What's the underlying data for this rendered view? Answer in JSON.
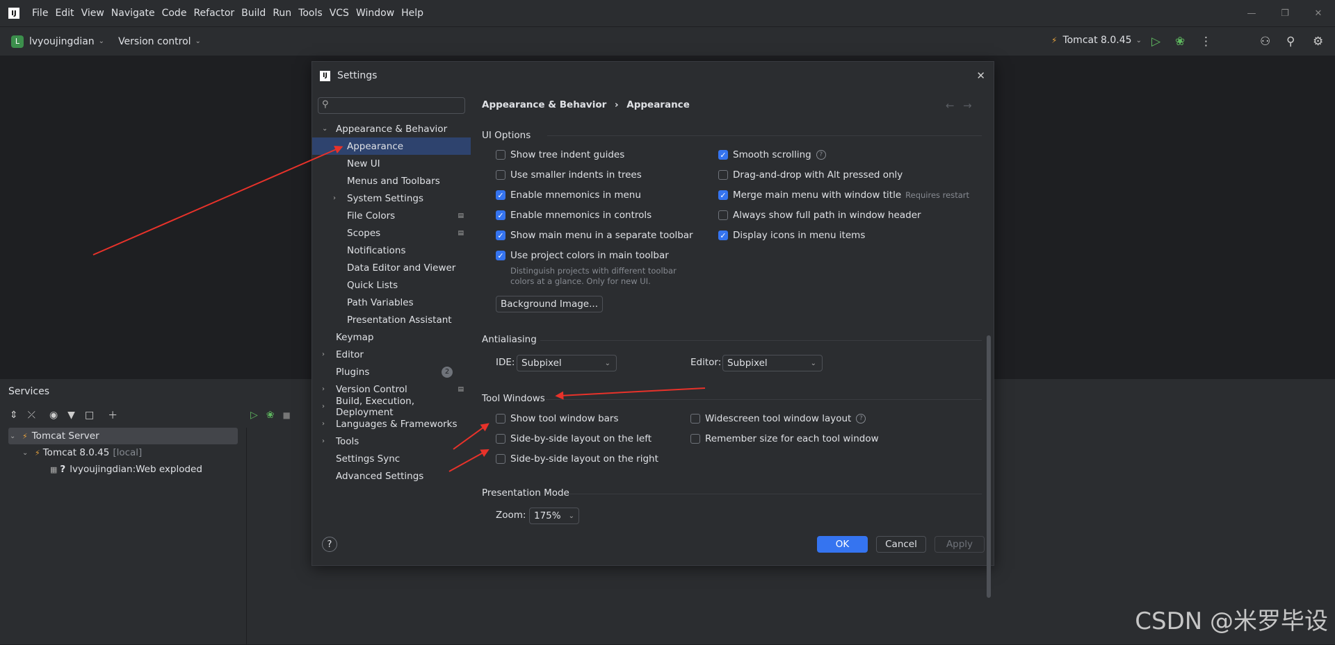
{
  "menubar": {
    "logo": "IJ",
    "items": [
      "File",
      "Edit",
      "View",
      "Navigate",
      "Code",
      "Refactor",
      "Build",
      "Run",
      "Tools",
      "VCS",
      "Window",
      "Help"
    ]
  },
  "toolbar": {
    "project_badge": "L",
    "project_name": "lvyoujingdian",
    "version_control": "Version control",
    "run_config": "Tomcat 8.0.45"
  },
  "services": {
    "title": "Services",
    "tree": [
      {
        "label": "Tomcat Server",
        "suffix": ""
      },
      {
        "label": "Tomcat 8.0.45",
        "suffix": "[local]"
      },
      {
        "label": "lvyoujingdian:Web exploded",
        "suffix": ""
      }
    ]
  },
  "dialog": {
    "title": "Settings",
    "search_placeholder": "",
    "nav": [
      {
        "label": "Appearance & Behavior"
      },
      {
        "label": "Appearance"
      },
      {
        "label": "New UI"
      },
      {
        "label": "Menus and Toolbars"
      },
      {
        "label": "System Settings"
      },
      {
        "label": "File Colors"
      },
      {
        "label": "Scopes"
      },
      {
        "label": "Notifications"
      },
      {
        "label": "Data Editor and Viewer"
      },
      {
        "label": "Quick Lists"
      },
      {
        "label": "Path Variables"
      },
      {
        "label": "Presentation Assistant"
      },
      {
        "label": "Keymap"
      },
      {
        "label": "Editor"
      },
      {
        "label": "Plugins",
        "badge": "2"
      },
      {
        "label": "Version Control"
      },
      {
        "label": "Build, Execution, Deployment"
      },
      {
        "label": "Languages & Frameworks"
      },
      {
        "label": "Tools"
      },
      {
        "label": "Settings Sync"
      },
      {
        "label": "Advanced Settings"
      }
    ],
    "breadcrumb": {
      "parent": "Appearance & Behavior",
      "sep": "›",
      "current": "Appearance"
    },
    "ui_options": {
      "title": "UI Options",
      "left": [
        {
          "label": "Show tree indent guides",
          "checked": false
        },
        {
          "label": "Use smaller indents in trees",
          "checked": false
        },
        {
          "label": "Enable mnemonics in menu",
          "checked": true
        },
        {
          "label": "Enable mnemonics in controls",
          "checked": true
        },
        {
          "label": "Show main menu in a separate toolbar",
          "checked": true
        },
        {
          "label": "Use project colors in main toolbar",
          "checked": true
        }
      ],
      "right": [
        {
          "label": "Smooth scrolling",
          "checked": true
        },
        {
          "label": "Drag-and-drop with Alt pressed only",
          "checked": false
        },
        {
          "label": "Merge main menu with window title",
          "checked": true,
          "hint": "Requires restart"
        },
        {
          "label": "Always show full path in window header",
          "checked": false
        },
        {
          "label": "Display icons in menu items",
          "checked": true
        }
      ],
      "project_colors_hint_1": "Distinguish projects with different toolbar",
      "project_colors_hint_2": "colors at a glance. Only for new UI.",
      "background_button": "Background Image..."
    },
    "antialiasing": {
      "title": "Antialiasing",
      "ide_label": "IDE:",
      "ide_value": "Subpixel",
      "editor_label": "Editor:",
      "editor_value": "Subpixel"
    },
    "tool_windows": {
      "title": "Tool Windows",
      "left": [
        {
          "label": "Show tool window bars",
          "checked": false
        },
        {
          "label": "Side-by-side layout on the left",
          "checked": false
        },
        {
          "label": "Side-by-side layout on the right",
          "checked": false
        }
      ],
      "right": [
        {
          "label": "Widescreen tool window layout",
          "checked": false
        },
        {
          "label": "Remember size for each tool window",
          "checked": false
        }
      ]
    },
    "presentation": {
      "title": "Presentation Mode",
      "zoom_label": "Zoom:",
      "zoom_value": "175%"
    },
    "buttons": {
      "help": "?",
      "ok": "OK",
      "cancel": "Cancel",
      "apply": "Apply"
    }
  },
  "watermark": "CSDN @米罗毕设",
  "colors": {
    "accent": "#3574f0",
    "selection": "#2e436e",
    "arrow": "#e8322a"
  }
}
